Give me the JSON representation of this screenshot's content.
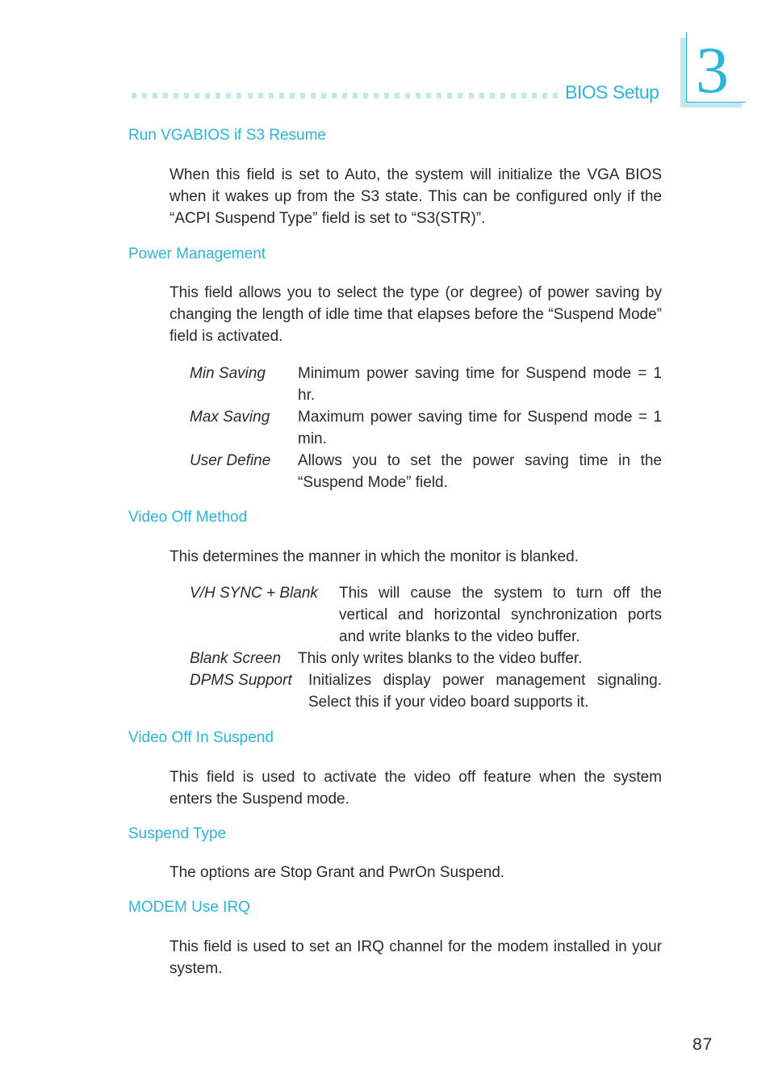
{
  "header": {
    "chapter_title": "BIOS Setup",
    "chapter_number": "3",
    "accent_color": "#2bb6d8",
    "accent_light_color": "#c3e6ef"
  },
  "sections": [
    {
      "heading": "Run VGABIOS if S3 Resume",
      "paragraph": "When this field is set to Auto, the system will initialize the VGA BIOS when it wakes up from the S3 state. This can be configured only if the “ACPI Suspend Type” field is set to “S3(STR)”."
    },
    {
      "heading": "Power Management",
      "paragraph": "This field allows you to select the type (or degree) of power saving by changing the length of idle time that elapses before the “Suspend Mode” field is activated.",
      "options": [
        {
          "term": "Min Saving",
          "desc": "Minimum power saving time for Suspend mode = 1 hr."
        },
        {
          "term": "Max Saving",
          "desc": "Maximum power saving time for Suspend mode = 1 min."
        },
        {
          "term": "User Define",
          "desc": "Allows you to set the power saving time in the “Suspend Mode” field."
        }
      ]
    },
    {
      "heading": "Video Off Method",
      "paragraph": "This determines the manner in which the monitor is blanked.",
      "options": [
        {
          "term": "V/H SYNC + Blank",
          "desc": "This will cause the system to turn off the vertical and horizontal synchronization ports and write blanks to the video buffer."
        },
        {
          "term": "Blank Screen",
          "desc": "This only writes blanks to the video buffer."
        },
        {
          "term": "DPMS Support",
          "desc": "Initializes display power management signaling. Select this if your video board supports it."
        }
      ]
    },
    {
      "heading": "Video Off In Suspend",
      "paragraph": "This field is used to activate the video off feature when the system enters the Suspend mode."
    },
    {
      "heading": "Suspend Type",
      "paragraph": "The options are Stop Grant and PwrOn Suspend."
    },
    {
      "heading": "MODEM Use IRQ",
      "paragraph": "This field is used to set an IRQ channel for the modem installed in your system."
    }
  ],
  "footer": {
    "page_number": "87"
  }
}
